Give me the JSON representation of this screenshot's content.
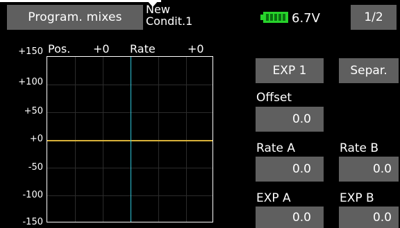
{
  "header": {
    "title": "Program. mixes",
    "condition_line1": "New",
    "condition_line2": "Condit.1",
    "voltage": "6.7V",
    "page": "1/2",
    "battery_color": "#27d32b"
  },
  "graph": {
    "y_labels": [
      "+150",
      "+100",
      "+50",
      "+0",
      "-50",
      "-100",
      "-150"
    ],
    "pos_label": "Pos.",
    "pos_value": "+0",
    "rate_label": "Rate",
    "rate_value": "+0",
    "colors": {
      "vertical_marker": "#30c8dd",
      "curve": "#d9b33a"
    }
  },
  "panel": {
    "exp1_button": "EXP 1",
    "separ_button": "Separ.",
    "offset_label": "Offset",
    "offset_value": "0.0",
    "rate_a_label": "Rate A",
    "rate_a_value": "0.0",
    "rate_b_label": "Rate B",
    "rate_b_value": "0.0",
    "exp_a_label": "EXP A",
    "exp_a_value": "0.0",
    "exp_b_label": "EXP B",
    "exp_b_value": "0.0"
  }
}
